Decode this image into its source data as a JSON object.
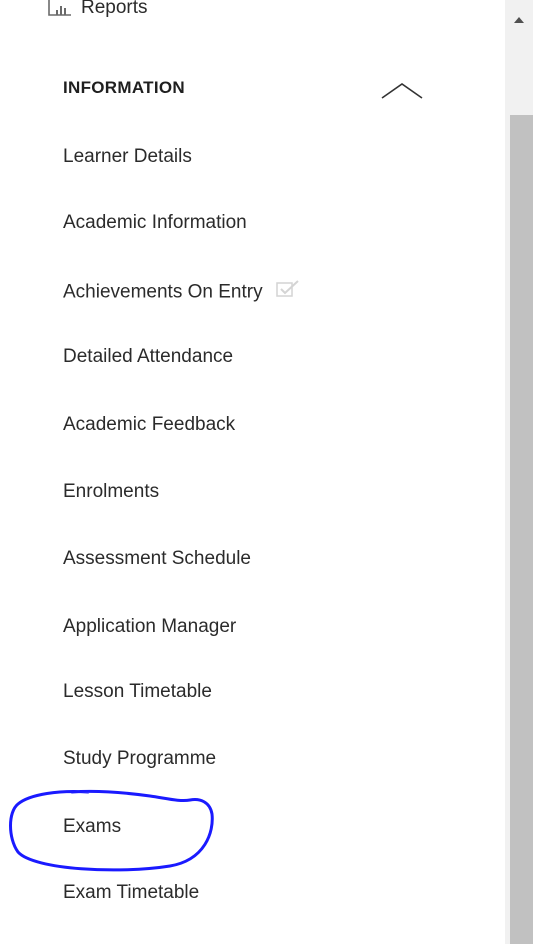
{
  "reports": {
    "label": "Reports",
    "icon": "bar-chart-icon"
  },
  "section": {
    "title": "INFORMATION",
    "toggle_icon": "chevron-up-icon"
  },
  "items": [
    {
      "label": "Learner Details"
    },
    {
      "label": "Academic Information"
    },
    {
      "label": "Achievements On Entry",
      "icon": "edit-check-icon"
    },
    {
      "label": "Detailed Attendance"
    },
    {
      "label": "Academic Feedback"
    },
    {
      "label": "Enrolments"
    },
    {
      "label": "Assessment Schedule"
    },
    {
      "label": "Application Manager"
    },
    {
      "label": "Lesson Timetable"
    },
    {
      "label": "Study Programme"
    },
    {
      "label": "Exams"
    },
    {
      "label": "Exam Timetable"
    }
  ],
  "annotation": {
    "target": "Exams",
    "color": "#1a1aff"
  },
  "colors": {
    "text": "#2b2b2b",
    "scrollbar_track": "#f1f1f1",
    "scrollbar_thumb": "#c1c1c1"
  }
}
